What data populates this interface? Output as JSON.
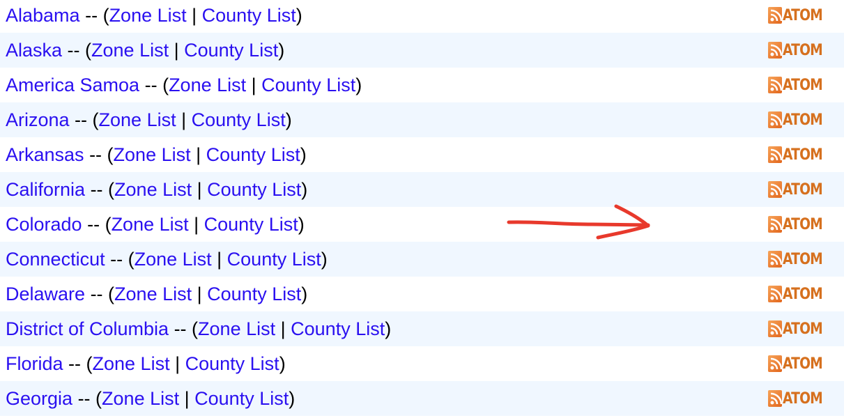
{
  "separator": " -- (",
  "pipe": " | ",
  "close_paren": ")",
  "zone_label": "Zone List",
  "county_label": "County List",
  "feed_label": "ATOM",
  "annotation": {
    "type": "red-arrow",
    "color": "#e8392c",
    "points_to": "Colorado ATOM feed"
  },
  "colors": {
    "link": "#2a10f0",
    "stripe": "#f0f7ff",
    "atom": "#d6701e"
  },
  "states": [
    {
      "name": "Alabama"
    },
    {
      "name": "Alaska"
    },
    {
      "name": "America Samoa"
    },
    {
      "name": "Arizona"
    },
    {
      "name": "Arkansas"
    },
    {
      "name": "California"
    },
    {
      "name": "Colorado"
    },
    {
      "name": "Connecticut"
    },
    {
      "name": "Delaware"
    },
    {
      "name": "District of Columbia"
    },
    {
      "name": "Florida"
    },
    {
      "name": "Georgia"
    }
  ]
}
